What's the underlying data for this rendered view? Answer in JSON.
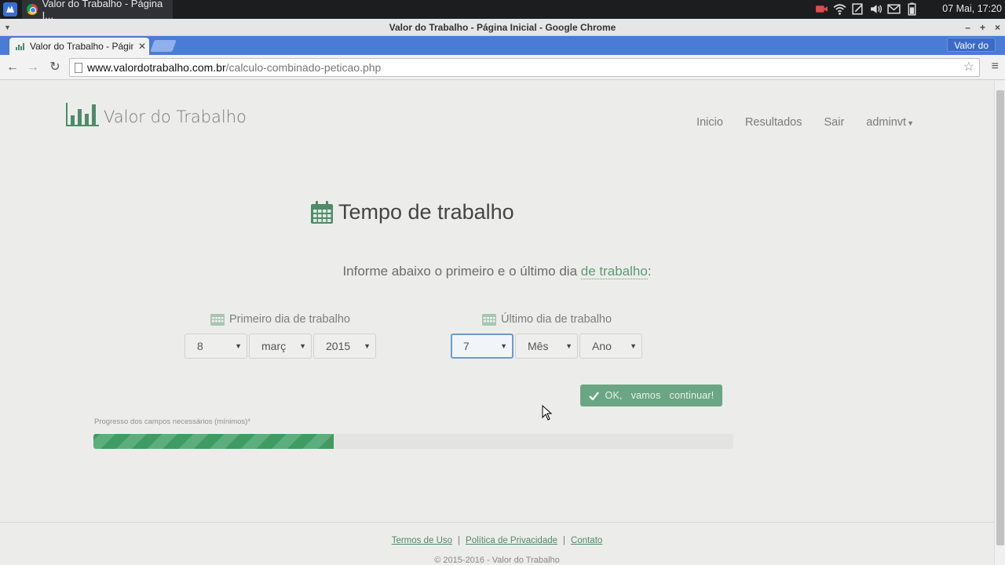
{
  "os": {
    "task_title": "Valor do Trabalho - Página I...",
    "clock": "07 Mai, 17:20",
    "tray_icons": [
      "camera-icon",
      "wifi-icon",
      "notes-icon",
      "volume-icon",
      "mail-icon",
      "battery-icon"
    ]
  },
  "window": {
    "title": "Valor do Trabalho - Página Inicial - Google Chrome",
    "controls": [
      "–",
      "+",
      "×"
    ]
  },
  "browser": {
    "tab_title": "Valor do Trabalho - Págin",
    "profile": "Valor do",
    "url_host": "www.valordotrabalho.com.br",
    "url_path": "/calculo-combinado-peticao.php"
  },
  "site": {
    "brand": "Valor do Trabalho",
    "nav": [
      "Inicio",
      "Resultados",
      "Sair",
      "adminvt"
    ],
    "accent": "#4f8b6a"
  },
  "main": {
    "title": "Tempo de trabalho",
    "subtitle_before": "Informe abaixo o primeiro e o último dia ",
    "subtitle_link": "de trabalho",
    "subtitle_after": ":",
    "first_day": {
      "label": "Primeiro dia de trabalho",
      "day": "8",
      "month": "març",
      "year": "2015"
    },
    "last_day": {
      "label": "Último dia de trabalho",
      "day": "7",
      "month": "Mês",
      "year": "Ano"
    },
    "ok_button": "OK,   vamos   continuar!",
    "progress_label": "Progresso dos campos necessários (mínimos)*",
    "progress": 0.375
  },
  "footer": {
    "terms": "Termos de Uso",
    "privacy": "Política de Privacidade",
    "contact": "Contato",
    "separator": "|",
    "copyright": "© 2015-2016 - Valor do Trabalho"
  }
}
